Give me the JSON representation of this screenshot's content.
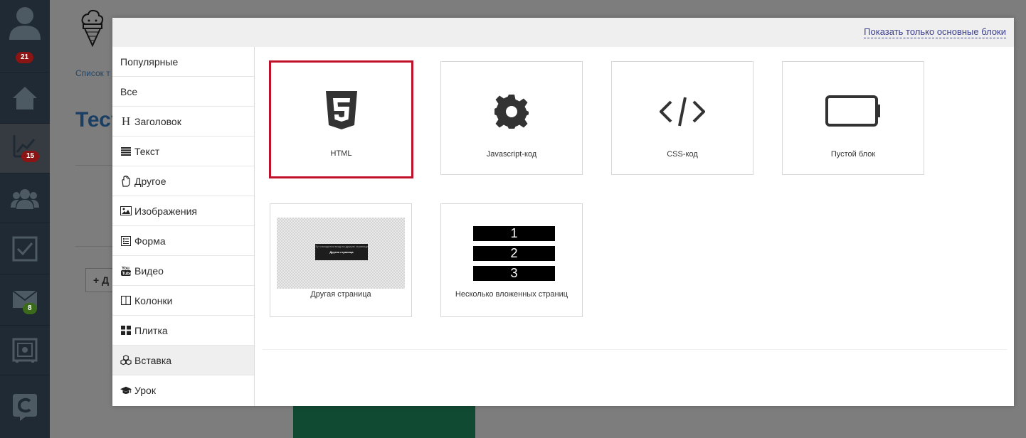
{
  "sidebar": {
    "badges": {
      "profile": "21",
      "stats": "15",
      "mail": "8"
    }
  },
  "background": {
    "breadcrumb": "Список т",
    "title": "Тест",
    "add_button": "+ Д"
  },
  "modal": {
    "header_link": "Показать только основные блоки",
    "categories": [
      {
        "label": "Популярные",
        "icon": ""
      },
      {
        "label": "Все",
        "icon": ""
      },
      {
        "label": "Заголовок",
        "icon": "heading-icon"
      },
      {
        "label": "Текст",
        "icon": "text-lines-icon"
      },
      {
        "label": "Другое",
        "icon": "hand-icon"
      },
      {
        "label": "Изображения",
        "icon": "image-icon"
      },
      {
        "label": "Форма",
        "icon": "form-icon"
      },
      {
        "label": "Видео",
        "icon": "youtube-icon"
      },
      {
        "label": "Колонки",
        "icon": "columns-icon"
      },
      {
        "label": "Плитка",
        "icon": "tiles-icon"
      },
      {
        "label": "Вставка",
        "icon": "cubes-icon",
        "active": true
      },
      {
        "label": "Урок",
        "icon": "graduation-cap-icon"
      }
    ],
    "heading_glyph": "H",
    "cards": [
      {
        "label": "HTML",
        "icon": "html5-icon",
        "selected": true
      },
      {
        "label": "Javascript-код",
        "icon": "gear-icon"
      },
      {
        "label": "CSS-код",
        "icon": "code-icon"
      },
      {
        "label": "Пустой блок",
        "icon": "empty-battery-icon"
      },
      {
        "label": "Другая страница",
        "icon": "page-thumbnail",
        "thumb_small_text": "Тут находится вход на другую страницу",
        "thumb_title": "Другая страница"
      },
      {
        "label": "Несколько вложенных страниц",
        "icon": "numbered-list",
        "rows": [
          "1",
          "2",
          "3"
        ]
      }
    ]
  },
  "colors": {
    "selected_border": "#c0102a",
    "link": "#3b3f8c",
    "sidebar_bg": "#1f2a34"
  }
}
